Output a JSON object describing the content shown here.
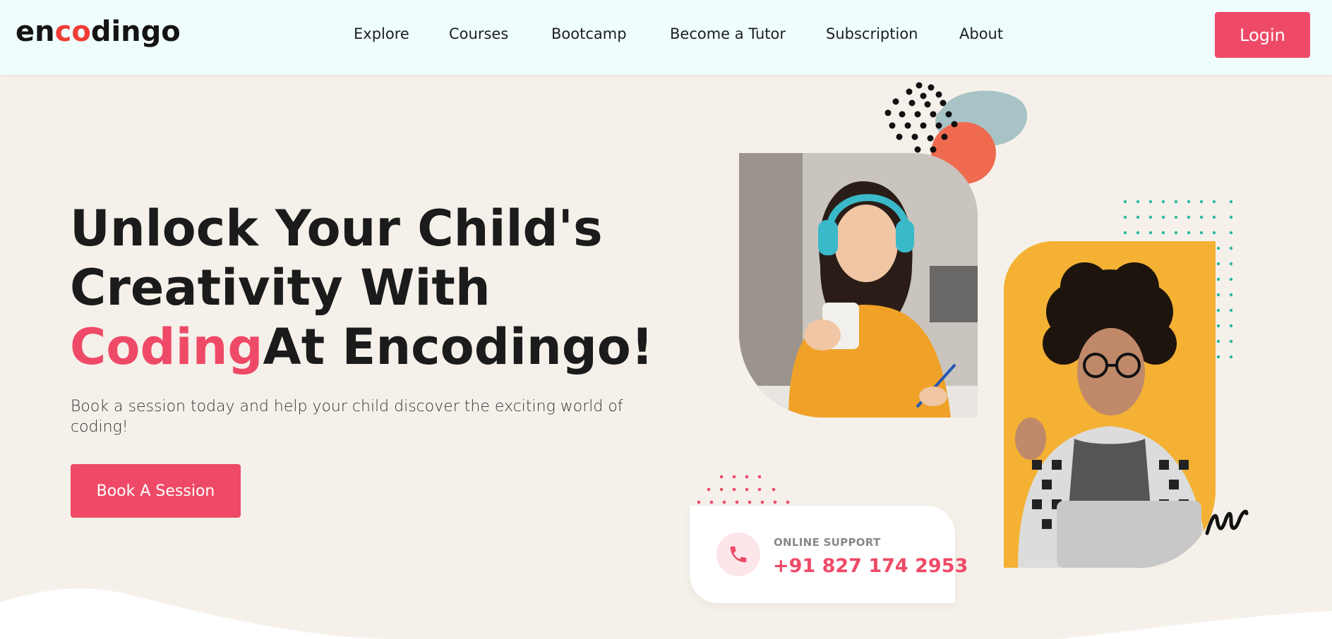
{
  "brand": {
    "logo_prefix": "en",
    "logo_accent": "co",
    "logo_suffix": "dingo",
    "accent_color": "#ee4a67",
    "logo_accent_color": "#ef3d35"
  },
  "nav": {
    "items": [
      "Explore",
      "Courses",
      "Bootcamp",
      "Become a Tutor",
      "Subscription",
      "About"
    ],
    "login_label": "Login"
  },
  "hero": {
    "title_line1": "Unlock Your Child's",
    "title_line2": "Creativity With",
    "title_highlight": "Coding",
    "title_line3_rest": "At Encodingo!",
    "subtitle": "Book a session today and help your child discover the exciting world of coding!",
    "cta_label": "Book A Session"
  },
  "support": {
    "label": "ONLINE SUPPORT",
    "phone": "+91 827 174 2953",
    "icon": "phone-icon"
  },
  "images": {
    "photo_1": "woman-with-headphones-writing",
    "photo_2": "curly-haired-man-with-laptop"
  }
}
